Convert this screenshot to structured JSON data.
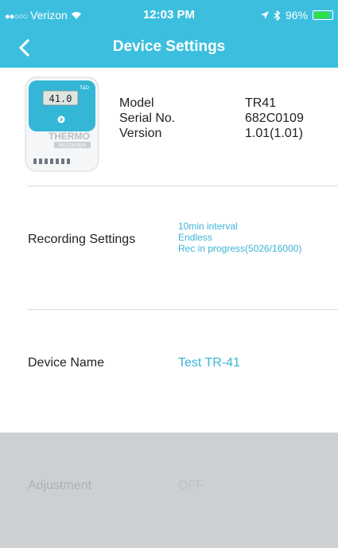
{
  "status_bar": {
    "carrier": "Verizon",
    "signal_dots": "●●○○○",
    "time": "12:03 PM",
    "battery": "96%",
    "battery_level_percent": 96
  },
  "nav": {
    "title": "Device Settings",
    "back_icon": "chevron-left-icon"
  },
  "device": {
    "image_display_value": "41.0",
    "image_brand": "T&D",
    "image_text_top": "THERMO",
    "image_text_bottom": "RECORDER",
    "labels": [
      "Model",
      "Serial No.",
      "Version"
    ],
    "values": [
      "TR41",
      "682C0109",
      "1.01(1.01)"
    ]
  },
  "recording": {
    "label": "Recording Settings",
    "lines": [
      "10min interval",
      "Endless",
      "Rec in progress(5026/16000)"
    ]
  },
  "device_name": {
    "label": "Device Name",
    "value": "Test TR-41"
  },
  "adjustment": {
    "label": "Adjustment",
    "value": "OFF"
  },
  "colors": {
    "accent": "#3cbfdf",
    "value_text": "#3ab5d6",
    "disabled_bg": "#cdd0d3"
  }
}
